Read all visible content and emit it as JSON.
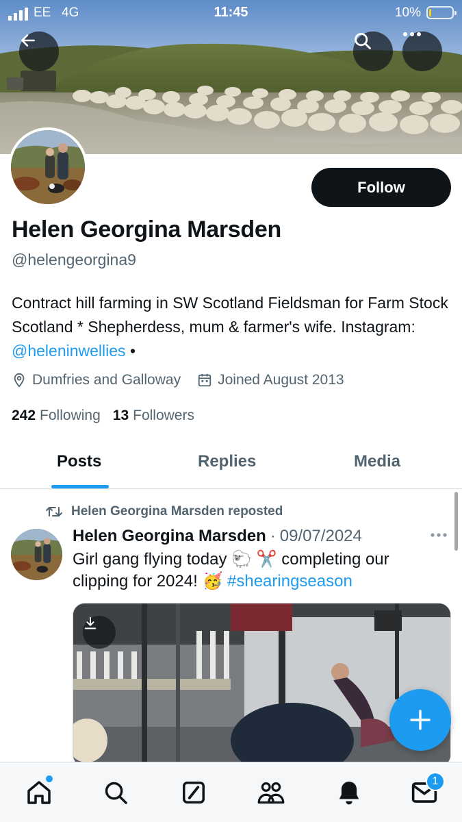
{
  "status_bar": {
    "carrier": "EE",
    "network": "4G",
    "time": "11:45",
    "battery_percent": "10%",
    "battery_level": 0.1
  },
  "header": {
    "back_icon": "arrow-left-icon",
    "search_icon": "search-icon",
    "more_icon": "more-horizontal-icon"
  },
  "profile": {
    "name": "Helen Georgina Marsden",
    "handle": "@helengeorgina9",
    "follow_label": "Follow",
    "bio_text": "Contract hill farming in SW Scotland Fieldsman for Farm Stock Scotland * Shepherdess, mum & farmer's wife. Instagram: ",
    "bio_link": "@heleninwellies",
    "bio_suffix": " •",
    "location": "Dumfries and Galloway",
    "joined": "Joined August 2013",
    "following_count": "242",
    "following_label": "Following",
    "followers_count": "13",
    "followers_label": "Followers"
  },
  "tabs": [
    {
      "label": "Posts",
      "active": true
    },
    {
      "label": "Replies",
      "active": false
    },
    {
      "label": "Media",
      "active": false
    }
  ],
  "post": {
    "repost_label": "Helen Georgina Marsden reposted",
    "author": "Helen Georgina Marsden",
    "separator": "·",
    "date": "09/07/2024",
    "text_line1": "Girl gang flying today 🐑 ✂️ completing our",
    "text_line2": "clipping for 2024! 🥳 ",
    "hashtag": "#shearingseason"
  },
  "bottom_nav": {
    "items": [
      "home-icon",
      "search-icon",
      "grok-icon",
      "communities-icon",
      "notifications-icon",
      "messages-icon"
    ],
    "messages_badge": "1"
  },
  "colors": {
    "accent": "#1d9bf0",
    "text": "#0f1419",
    "secondary": "#536471"
  }
}
